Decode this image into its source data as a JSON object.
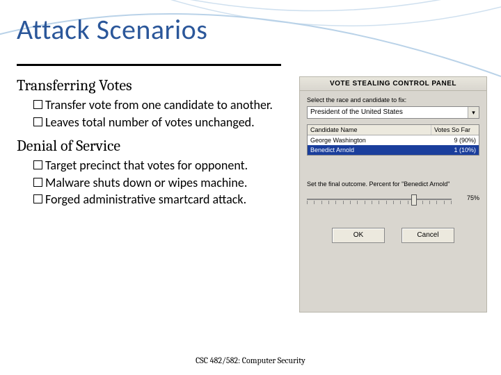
{
  "title": "Attack Scenarios",
  "sections": [
    {
      "heading": "Transferring Votes",
      "bullets": [
        "Transfer vote from one candidate to another.",
        "Leaves total number of votes unchanged."
      ]
    },
    {
      "heading": "Denial of Service",
      "bullets": [
        "Target precinct that votes for opponent.",
        "Malware shuts down or wipes machine.",
        "Forged administrative smartcard attack."
      ]
    }
  ],
  "footer": "CSC 482/582: Computer Security",
  "panel": {
    "title": "VOTE STEALING CONTROL PANEL",
    "select_label": "Select the race and candidate to fix:",
    "select_value": "President of the United States",
    "columns": {
      "c1": "Candidate Name",
      "c2": "Votes So Far"
    },
    "rows": [
      {
        "name": "George Washington",
        "votes": "9 (90%)"
      },
      {
        "name": "Benedict Arnold",
        "votes": "1 (10%)"
      }
    ],
    "slider_label": "Set the final outcome. Percent for \"Benedict Arnold\"",
    "slider_value": "75%",
    "slider_percent": 75,
    "buttons": {
      "ok": "OK",
      "cancel": "Cancel"
    }
  }
}
